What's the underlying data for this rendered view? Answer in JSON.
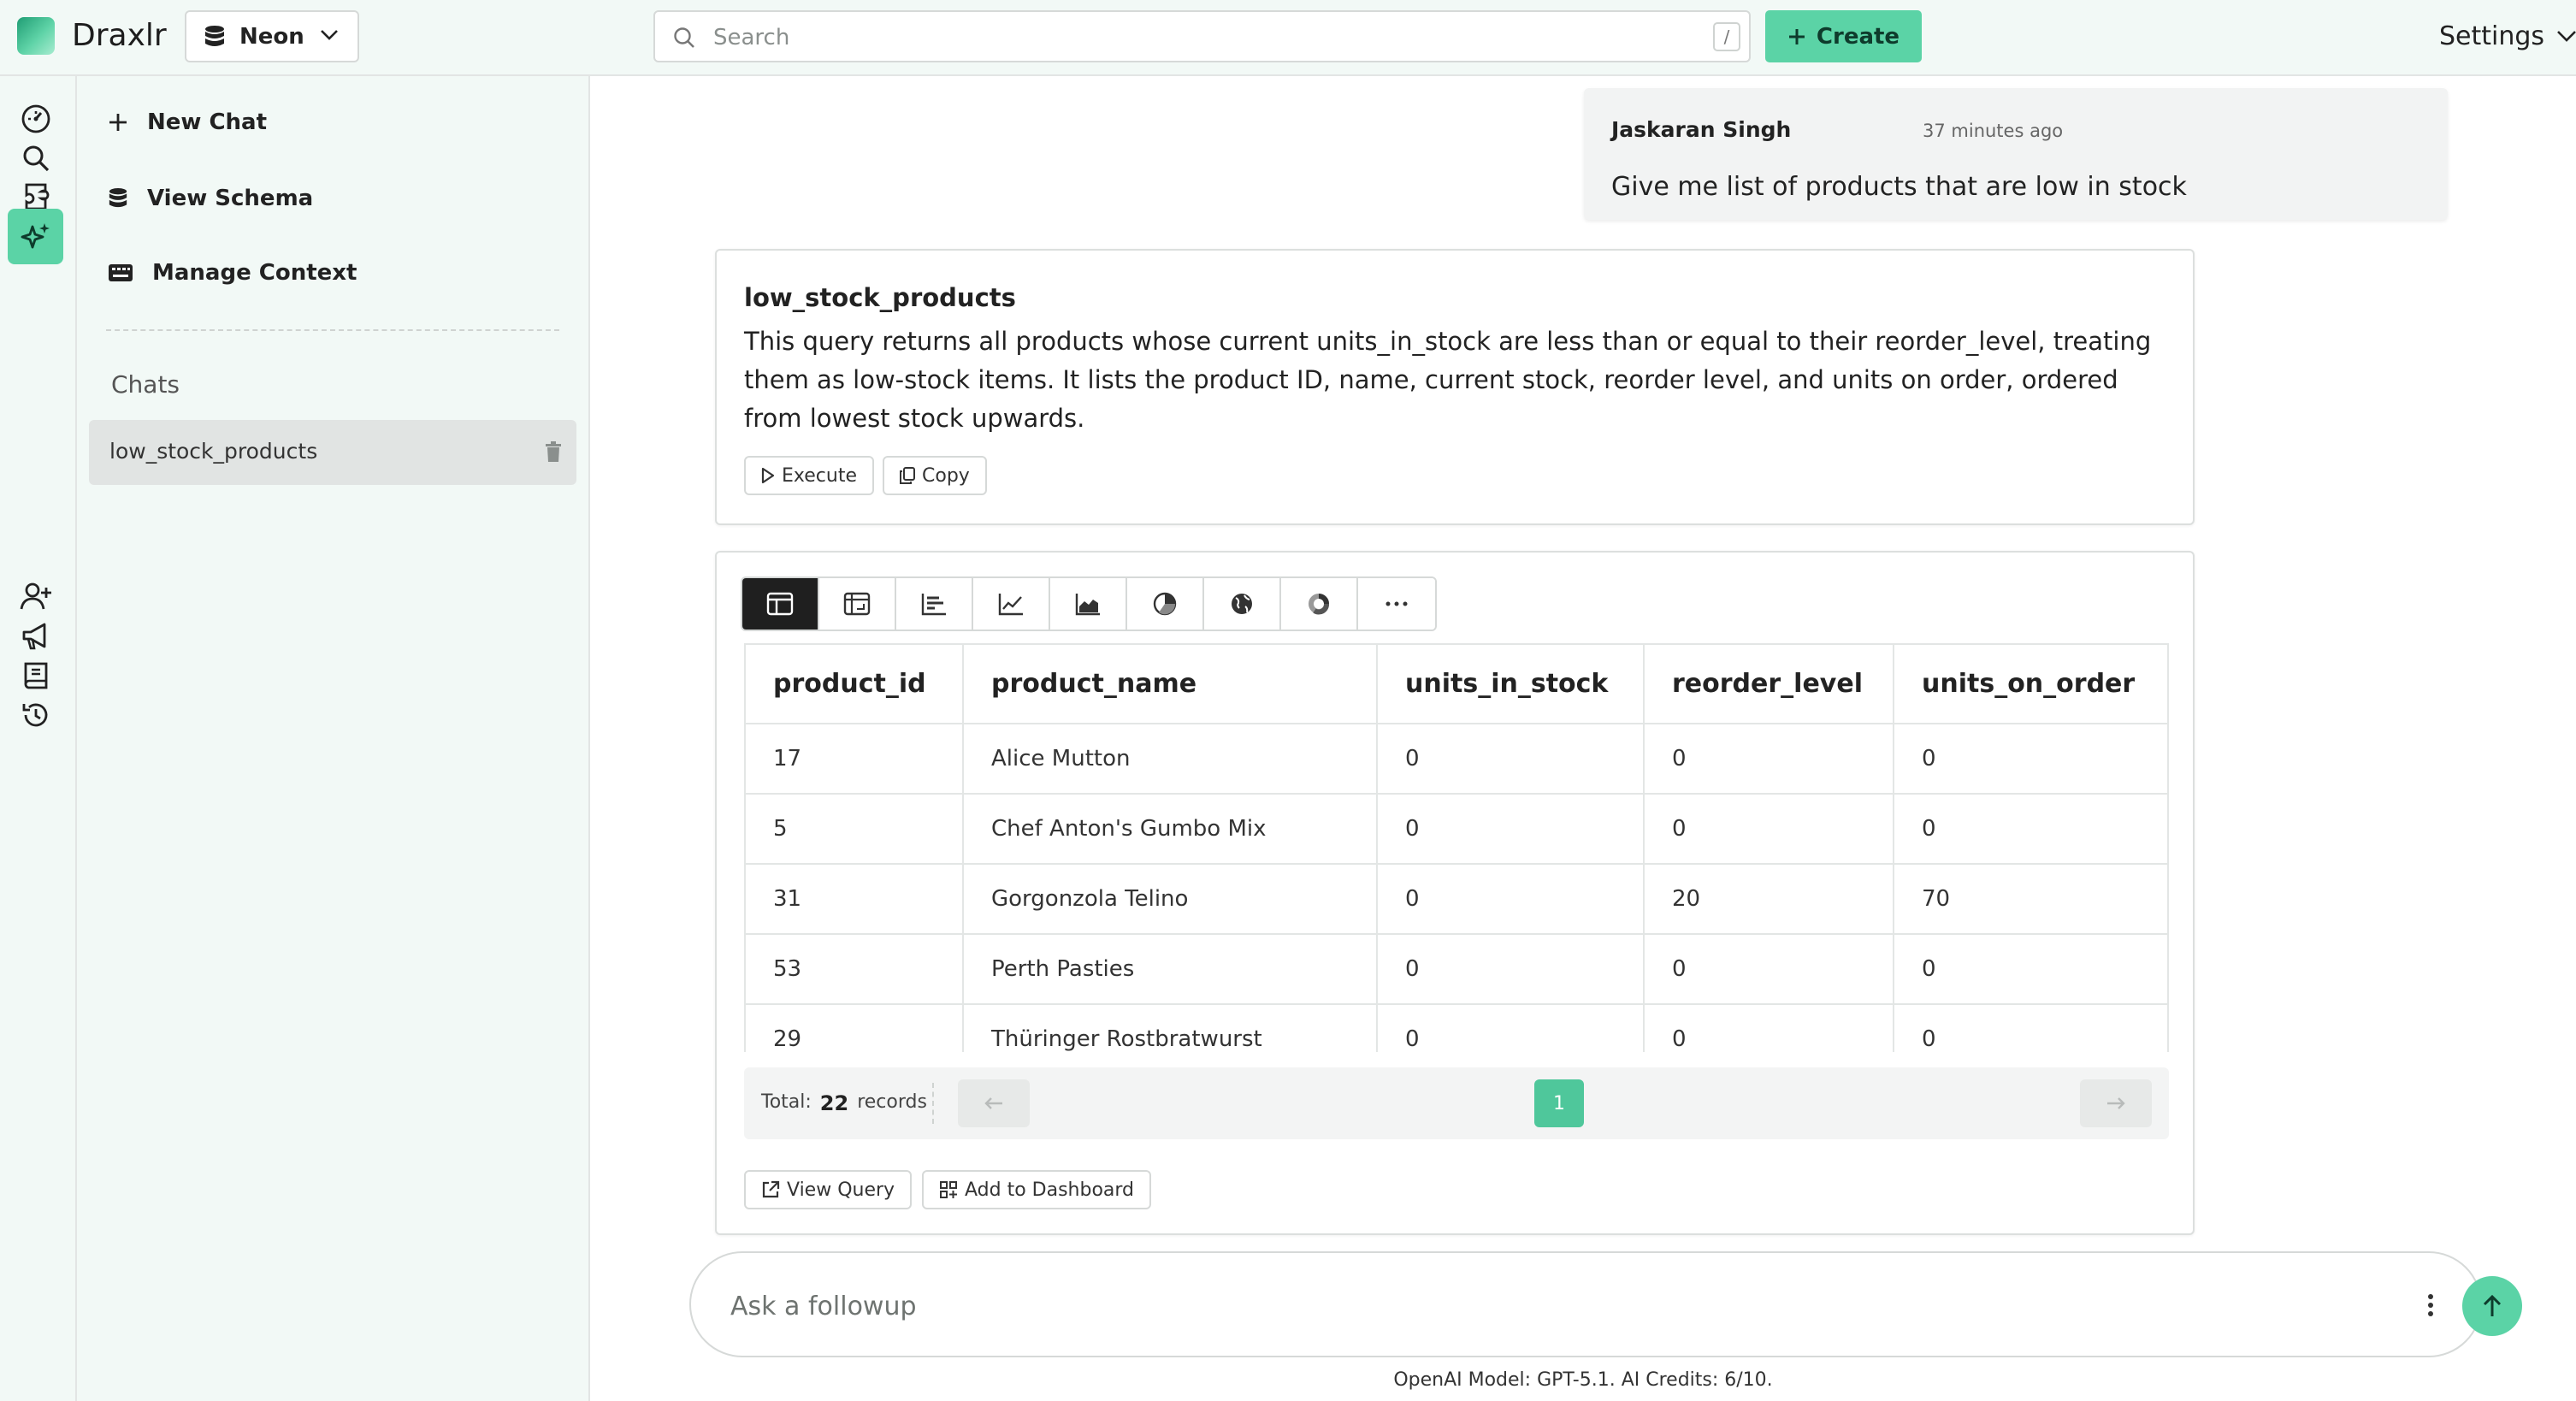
{
  "app": {
    "name": "Draxlr"
  },
  "topbar": {
    "database": "Neon",
    "search_placeholder": "Search",
    "search_shortcut": "/",
    "create_label": "Create",
    "settings_label": "Settings"
  },
  "rail": {
    "icons": [
      "dashboard-icon",
      "search-icon",
      "queries-icon",
      "ai-sparkles-icon",
      "add-user-icon",
      "megaphone-icon",
      "book-icon",
      "history-icon"
    ],
    "active": "ai-sparkles-icon",
    "accent": "#5bd3a6"
  },
  "sidebar": {
    "actions": [
      {
        "label": "New Chat",
        "icon": "plus-icon"
      },
      {
        "label": "View Schema",
        "icon": "database-icon"
      },
      {
        "label": "Manage Context",
        "icon": "keyboard-icon"
      }
    ],
    "chats_heading": "Chats",
    "chats": [
      {
        "label": "low_stock_products",
        "selected": true
      }
    ]
  },
  "message": {
    "author": "Jaskaran Singh",
    "time": "37 minutes ago",
    "text": "Give me list of products that are low in stock"
  },
  "query": {
    "title": "low_stock_products",
    "description": "This query returns all products whose current units_in_stock are less than or equal to their reorder_level, treating them as low-stock items. It lists the product ID, name, current stock, reorder level, and units on order, ordered from lowest stock upwards.",
    "execute_label": "Execute",
    "copy_label": "Copy"
  },
  "result": {
    "viz_types": [
      "table",
      "pivot-table",
      "bar",
      "line",
      "area",
      "pie",
      "map",
      "donut",
      "more"
    ],
    "active_viz": "table",
    "columns": [
      "product_id",
      "product_name",
      "units_in_stock",
      "reorder_level",
      "units_on_order"
    ],
    "rows": [
      [
        "17",
        "Alice Mutton",
        "0",
        "0",
        "0"
      ],
      [
        "5",
        "Chef Anton's Gumbo Mix",
        "0",
        "0",
        "0"
      ],
      [
        "31",
        "Gorgonzola Telino",
        "0",
        "20",
        "70"
      ],
      [
        "53",
        "Perth Pasties",
        "0",
        "0",
        "0"
      ],
      [
        "29",
        "Thüringer Rostbratwurst",
        "0",
        "0",
        "0"
      ]
    ],
    "total_label": "Total:",
    "total_count": "22",
    "records_label": "records",
    "current_page": "1",
    "view_query_label": "View Query",
    "add_dashboard_label": "Add to Dashboard"
  },
  "followup": {
    "placeholder": "Ask a followup",
    "footnote": "OpenAI Model: GPT-5.1. AI Credits: 6/10."
  }
}
